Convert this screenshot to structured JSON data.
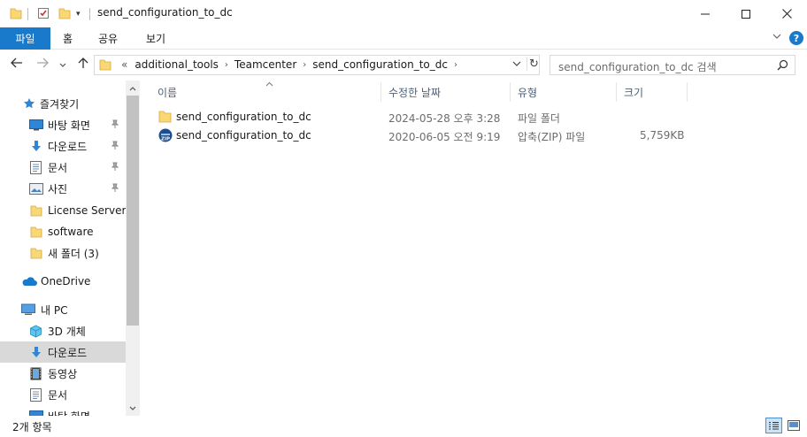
{
  "window": {
    "title": "send_configuration_to_dc",
    "minimize_glyph": "—",
    "maximize_glyph": "☐",
    "close_glyph": "✕"
  },
  "ribbon": {
    "tabs": [
      {
        "label": "파일"
      },
      {
        "label": "홈"
      },
      {
        "label": "공유"
      },
      {
        "label": "보기"
      }
    ],
    "expand_glyph": "⌄",
    "help_glyph": "?"
  },
  "nav": {
    "back_glyph": "←",
    "forward_glyph": "→",
    "recent_glyph": "⌄",
    "up_glyph": "↑"
  },
  "address": {
    "overflow": "«",
    "crumbs": [
      "additional_tools",
      "Teamcenter",
      "send_configuration_to_dc"
    ],
    "sep": "›",
    "dropdown_glyph": "⌄",
    "refresh_glyph": "↻"
  },
  "search": {
    "placeholder": "send_configuration_to_dc 검색"
  },
  "sidebar": {
    "items": [
      {
        "label": "즐겨찾기",
        "icon": "star-icon"
      },
      {
        "label": "바탕 화면",
        "icon": "desktop-icon",
        "pinned": true
      },
      {
        "label": "다운로드",
        "icon": "download-icon",
        "pinned": true
      },
      {
        "label": "문서",
        "icon": "document-icon",
        "pinned": true
      },
      {
        "label": "사진",
        "icon": "pictures-icon",
        "pinned": true
      },
      {
        "label": "License Server",
        "icon": "folder-icon"
      },
      {
        "label": "software",
        "icon": "folder-icon"
      },
      {
        "label": "새 폴더 (3)",
        "icon": "folder-icon"
      },
      {
        "label": "OneDrive",
        "icon": "cloud-icon"
      },
      {
        "label": "내 PC",
        "icon": "computer-icon"
      },
      {
        "label": "3D 개체",
        "icon": "cube-icon"
      },
      {
        "label": "다운로드",
        "icon": "download-icon",
        "selected": true
      },
      {
        "label": "동영상",
        "icon": "video-icon"
      },
      {
        "label": "문서",
        "icon": "document-icon"
      },
      {
        "label": "바탕 화면",
        "icon": "desktop-icon"
      }
    ],
    "scroll_up_glyph": "▲",
    "scroll_down_glyph": "▼",
    "pin_glyph": "📌"
  },
  "columns": {
    "name": "이름",
    "date": "수정한 날짜",
    "type": "유형",
    "size": "크기",
    "sort_glyph": "⌃"
  },
  "files": [
    {
      "name": "send_configuration_to_dc",
      "date": "2024-05-28 오후 3:28",
      "type": "파일 폴더",
      "size": "",
      "icon": "folder-icon"
    },
    {
      "name": "send_configuration_to_dc",
      "date": "2020-06-05 오전 9:19",
      "type": "압축(ZIP) 파일",
      "size": "5,759KB",
      "icon": "zip-icon"
    }
  ],
  "status": {
    "count_text": "2개 항목"
  },
  "colors": {
    "accent": "#1979ca",
    "folder": "#f8d775",
    "selected_bg": "#d9d9d9"
  }
}
